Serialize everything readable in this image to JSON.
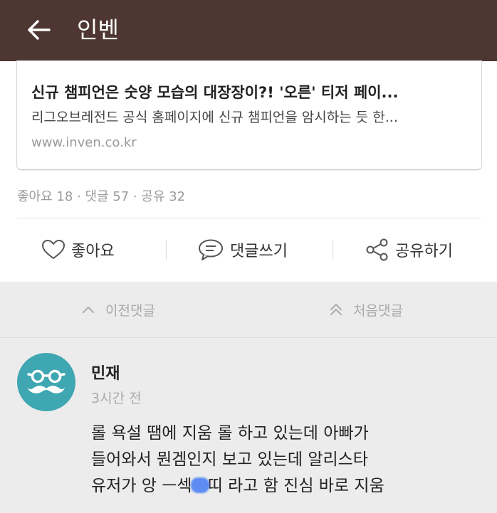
{
  "appbar": {
    "title": "인벤",
    "back_icon": "arrow-left-icon",
    "background": "#4e3732"
  },
  "link_card": {
    "title": "신규 챔피언은 숫양 모습의 대장장이?! '오른' 티저 페이...",
    "description": "리그오브레전드 공식 홈페이지에 신규 챔피언을 암시하는 듯 한...",
    "url": "www.inven.co.kr"
  },
  "stats": {
    "text": "좋아요 18 · 댓글 57 · 공유 32"
  },
  "actions": {
    "like_label": "좋아요",
    "like_icon": "heart-icon",
    "comment_label": "댓글쓰기",
    "comment_icon": "speech-bubble-icon",
    "share_label": "공유하기",
    "share_icon": "share-icon"
  },
  "comment_nav": {
    "prev_label": "이전댓글",
    "prev_icon": "chevron-up-icon",
    "first_label": "처음댓글",
    "first_icon": "double-chevron-up-icon"
  },
  "comment": {
    "author": "민재",
    "time": "3시간 전",
    "avatar_icon": "glasses-mustache-icon",
    "avatar_color": "#3fa7b2",
    "line1": "롤 욕설 땜에 지움 롤 하고 있는데 아빠가",
    "line2": "들어와서 뭔겜인지 보고 있는데 알리스타",
    "line3_before": "유저가 앙 ㅡ섹",
    "line3_after": "띠 라고 함 진심 바로 지움"
  }
}
